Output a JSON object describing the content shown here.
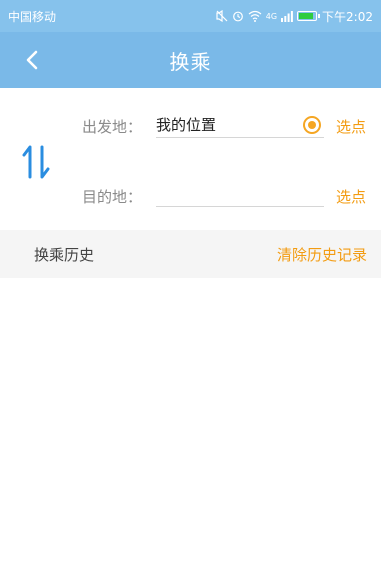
{
  "status_bar": {
    "carrier": "中国移动",
    "time": "下午2:02",
    "icons": [
      "mute-icon",
      "alarm-icon",
      "wifi-icon",
      "signal-icon",
      "battery-icon"
    ],
    "network_label": "4G"
  },
  "header": {
    "title": "换乘",
    "back_icon": "chevron-left-icon"
  },
  "route": {
    "origin": {
      "label": "出发地：",
      "value": "我的位置",
      "pick_label": "选点"
    },
    "destination": {
      "label": "目的地：",
      "value": "",
      "pick_label": "选点"
    },
    "swap_icon": "swap-vertical-icon"
  },
  "history": {
    "title": "换乘历史",
    "clear_label": "清除历史记录"
  },
  "colors": {
    "header_bg": "#7ab9e8",
    "status_bg": "#86c2ec",
    "accent_orange": "#f39c12",
    "swap_blue": "#2a8de0"
  }
}
